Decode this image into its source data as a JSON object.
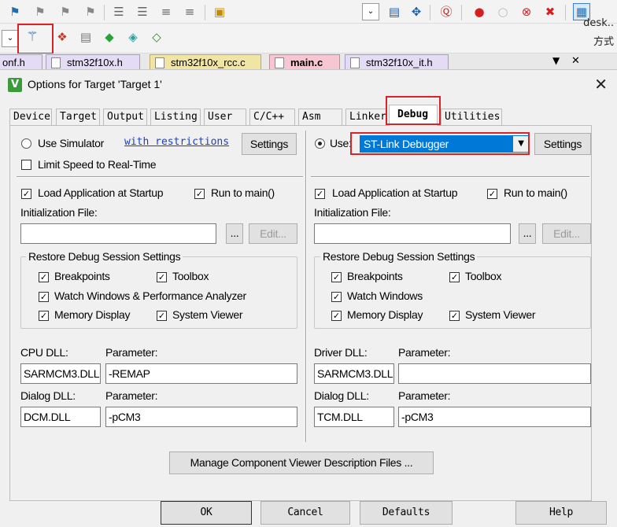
{
  "ide": {
    "desk_text": "desk..",
    "ime_text": "方式",
    "file_tabs": [
      {
        "label": "onf.h",
        "kind": "h"
      },
      {
        "label": "stm32f10x.h",
        "kind": "h"
      },
      {
        "label": "stm32f10x_rcc.c",
        "kind": "c"
      },
      {
        "label": "main.c",
        "kind": "active"
      },
      {
        "label": "stm32f10x_it.h",
        "kind": "h"
      }
    ],
    "tabs_menu_glyph": "▼",
    "tabs_close_glyph": "✕"
  },
  "dialog": {
    "title": "Options for Target 'Target 1'",
    "close_glyph": "✕",
    "tabs": [
      "Device",
      "Target",
      "Output",
      "Listing",
      "User",
      "C/C++",
      "Asm",
      "Linker",
      "Debug",
      "Utilities"
    ],
    "active_tab": "Debug",
    "left": {
      "use_simulator_label": "Use Simulator",
      "with_restrictions": "with restrictions",
      "settings_label": "Settings",
      "limit_speed_label": "Limit Speed to Real-Time",
      "load_app_label": "Load Application at Startup",
      "run_to_main_label": "Run to main()",
      "init_file_label": "Initialization File:",
      "init_file_value": "",
      "browse_label": "...",
      "edit_label": "Edit...",
      "restore_title": "Restore Debug Session Settings",
      "breakpoints": "Breakpoints",
      "toolbox": "Toolbox",
      "watch": "Watch Windows & Performance Analyzer",
      "memory": "Memory Display",
      "system_viewer": "System Viewer",
      "cpu_dll_label": "CPU DLL:",
      "cpu_param_label": "Parameter:",
      "cpu_dll_value": "SARMCM3.DLL",
      "cpu_param_value": "-REMAP",
      "dialog_dll_label": "Dialog DLL:",
      "dialog_param_label": "Parameter:",
      "dialog_dll_value": "DCM.DLL",
      "dialog_param_value": "-pCM3"
    },
    "right": {
      "use_label": "Use:",
      "debugger_value": "ST-Link Debugger",
      "settings_label": "Settings",
      "load_app_label": "Load Application at Startup",
      "run_to_main_label": "Run to main()",
      "init_file_label": "Initialization File:",
      "init_file_value": "",
      "browse_label": "...",
      "edit_label": "Edit...",
      "restore_title": "Restore Debug Session Settings",
      "breakpoints": "Breakpoints",
      "toolbox": "Toolbox",
      "watch": "Watch Windows",
      "memory": "Memory Display",
      "system_viewer": "System Viewer",
      "driver_dll_label": "Driver DLL:",
      "driver_param_label": "Parameter:",
      "driver_dll_value": "SARMCM3.DLL",
      "driver_param_value": "",
      "dialog_dll_label": "Dialog DLL:",
      "dialog_param_label": "Parameter:",
      "dialog_dll_value": "TCM.DLL",
      "dialog_param_value": "-pCM3"
    },
    "manage_button": "Manage Component Viewer Description Files ...",
    "buttons": {
      "ok": "OK",
      "cancel": "Cancel",
      "defaults": "Defaults",
      "help": "Help"
    }
  },
  "colors": {
    "highlight_box": "#d8232a",
    "selection": "#0078d7",
    "link": "#1a3fc4"
  }
}
